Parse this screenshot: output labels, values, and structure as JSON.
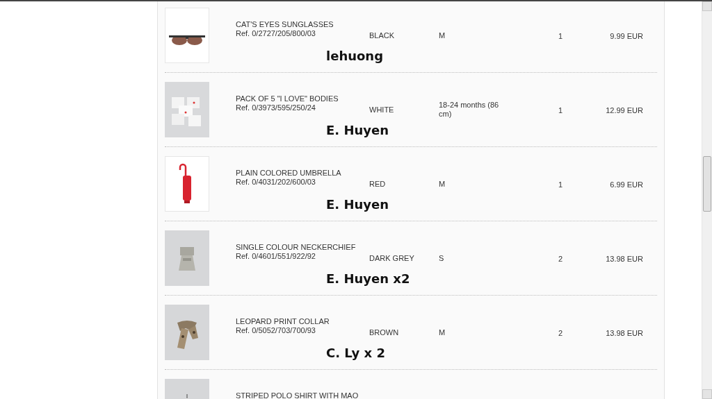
{
  "order_items": [
    {
      "name": "CAT'S EYES SUNGLASSES",
      "ref": "Ref. 0/2727/205/800/03",
      "colour": "BLACK",
      "size": "M",
      "quantity": "1",
      "price": "9.99 EUR",
      "annotation": "lehuong"
    },
    {
      "name": "PACK OF 5 \"I LOVE\" BODIES",
      "ref": "Ref. 0/3973/595/250/24",
      "colour": "WHITE",
      "size": "18-24 months (86 cm)",
      "quantity": "1",
      "price": "12.99 EUR",
      "annotation": "E. Huyen"
    },
    {
      "name": "PLAIN COLORED UMBRELLA",
      "ref": "Ref. 0/4031/202/600/03",
      "colour": "RED",
      "size": "M",
      "quantity": "1",
      "price": "6.99 EUR",
      "annotation": "E. Huyen"
    },
    {
      "name": "SINGLE COLOUR NECKERCHIEF",
      "ref": "Ref. 0/4601/551/922/92",
      "colour": "DARK GREY",
      "size": "S",
      "quantity": "2",
      "price": "13.98 EUR",
      "annotation": "E. Huyen x2"
    },
    {
      "name": "LEOPARD PRINT COLLAR",
      "ref": "Ref. 0/5052/703/700/93",
      "colour": "BROWN",
      "size": "M",
      "quantity": "2",
      "price": "13.98 EUR",
      "annotation": "C. Ly x 2"
    },
    {
      "name": "STRIPED POLO SHIRT WITH MAO"
    }
  ]
}
